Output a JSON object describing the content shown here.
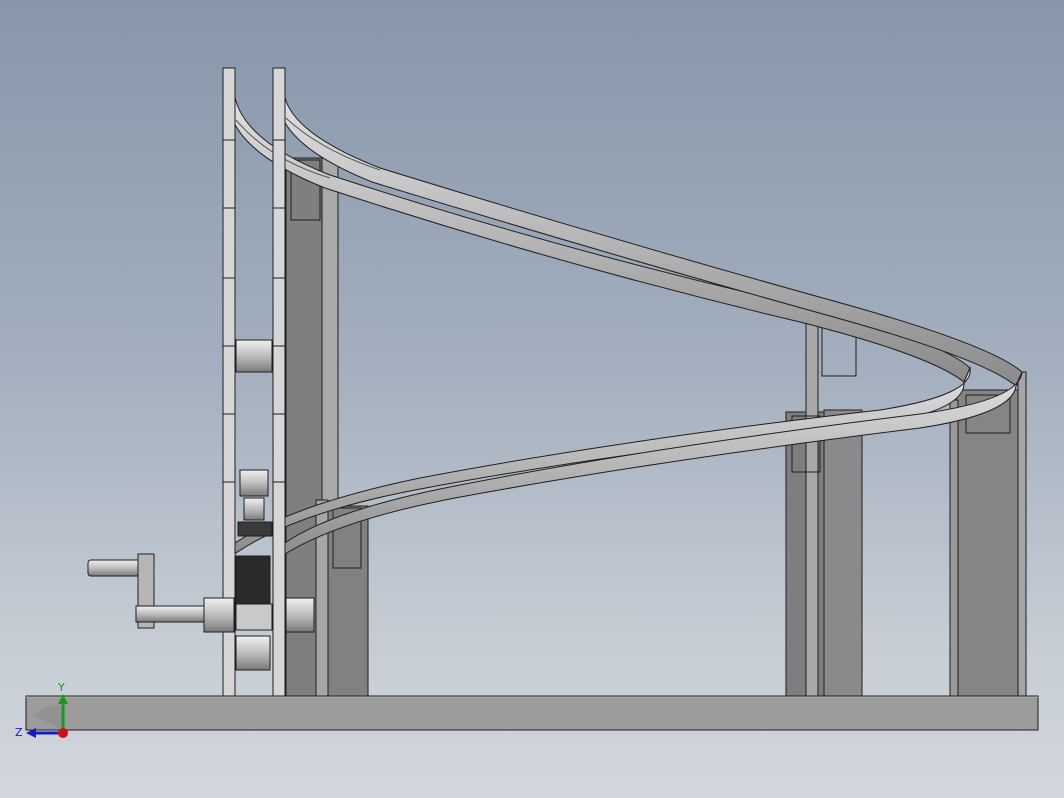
{
  "viewport": {
    "background_top": "#8796ab",
    "background_bottom": "#d3d7dc"
  },
  "model": {
    "description_icons": [
      "base-plate",
      "support-posts",
      "helical-track",
      "chain-lift",
      "hand-crank"
    ],
    "colors": {
      "steel_light": "#c8c8c8",
      "steel_mid": "#9a9a9a",
      "steel_dark": "#6e6e6e",
      "edge": "#1e1e1e",
      "sprocket": "#2a2a2a"
    }
  },
  "triad": {
    "y_label": "Y",
    "z_label": "Z",
    "y_color": "#1a9a1a",
    "z_color": "#1a1ac8",
    "x_color": "#d01010"
  }
}
